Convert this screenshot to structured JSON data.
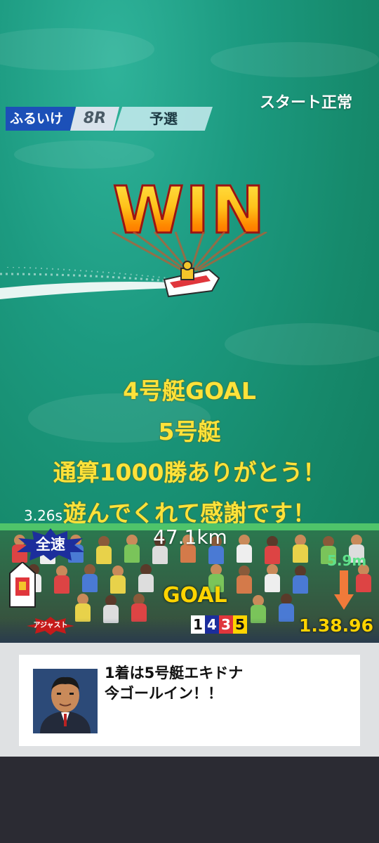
{
  "race": {
    "venue": "ふるいけ",
    "race_number": "8R",
    "race_type": "予選",
    "start_status": "スタート正常"
  },
  "banner": {
    "win_text": "WIN"
  },
  "messages": [
    "4号艇GOAL",
    "5号艇",
    "通算1000勝ありがとう！",
    "遊んでくれて感謝です！"
  ],
  "hud": {
    "timer": "3.26s",
    "throttle_label": "全速",
    "speed": "47.1km",
    "distance_to_goal": "5.9m",
    "goal_label": "GOAL",
    "finish_order": [
      "1",
      "4",
      "3",
      "5"
    ],
    "race_time": "1.38.96",
    "assist_label": "アジャスト"
  },
  "commentary": {
    "line1": "1着は5号艇エキドナ",
    "line2": "今ゴールイン！！"
  },
  "colors": {
    "water": "#1c9a80",
    "message_yellow": "#ffe23a",
    "goal_yellow": "#ffd400",
    "distance_green": "#5fe08a",
    "burst_blue": "#1c2e9c",
    "venue_blue": "#1c50b8"
  },
  "icons": {
    "throttle": "star-burst-icon",
    "distance_arrow": "down-arrow-icon",
    "boat": "boat-icon",
    "commentator": "announcer-avatar-icon"
  }
}
